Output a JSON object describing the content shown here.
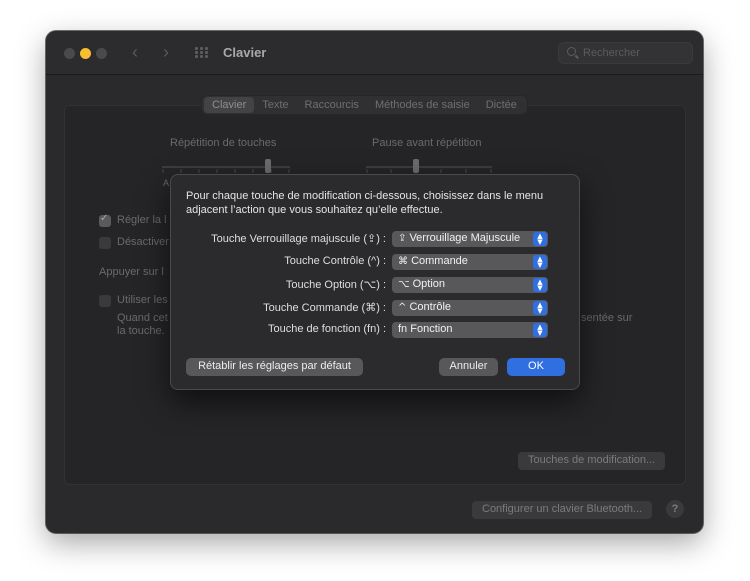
{
  "window": {
    "title": "Clavier",
    "search_placeholder": "Rechercher"
  },
  "tabs": [
    "Clavier",
    "Texte",
    "Raccourcis",
    "Méthodes de saisie",
    "Dictée"
  ],
  "background": {
    "repetition_label": "Répétition de touches",
    "pause_label": "Pause avant répétition",
    "slider_left_label": "A",
    "check1_label": "Régler la l",
    "check2_label": "Désactiver",
    "press_label": "Appuyer sur l",
    "check3_label": "Utiliser les",
    "note_line1": "Quand cet",
    "note_line2": "la touche.",
    "right_note": "sentée sur",
    "modifier_button": "Touches de modification...",
    "bluetooth_button": "Configurer un clavier Bluetooth...",
    "help": "?"
  },
  "sheet": {
    "message": "Pour chaque touche de modification ci-dessous, choisissez dans le menu adjacent l’action que vous souhaitez qu’elle effectue.",
    "rows": [
      {
        "label": "Touche Verrouillage majuscule (⇪) :",
        "symbol": "⇪",
        "value": "Verrouillage Majuscule"
      },
      {
        "label": "Touche Contrôle (^) :",
        "symbol": "⌘",
        "value": "Commande"
      },
      {
        "label": "Touche Option (⌥) :",
        "symbol": "⌥",
        "value": "Option"
      },
      {
        "label": "Touche Commande (⌘) :",
        "symbol": "^",
        "value": "Contrôle"
      },
      {
        "label": "Touche de fonction (fn) :",
        "symbol": "fn",
        "value": "Fonction"
      }
    ],
    "restore_button": "Rétablir les réglages par défaut",
    "cancel_button": "Annuler",
    "ok_button": "OK"
  },
  "colors": {
    "accent": "#2f6fe0",
    "window_bg": "#2a2a2c",
    "sheet_bg": "#2b2b2d"
  }
}
